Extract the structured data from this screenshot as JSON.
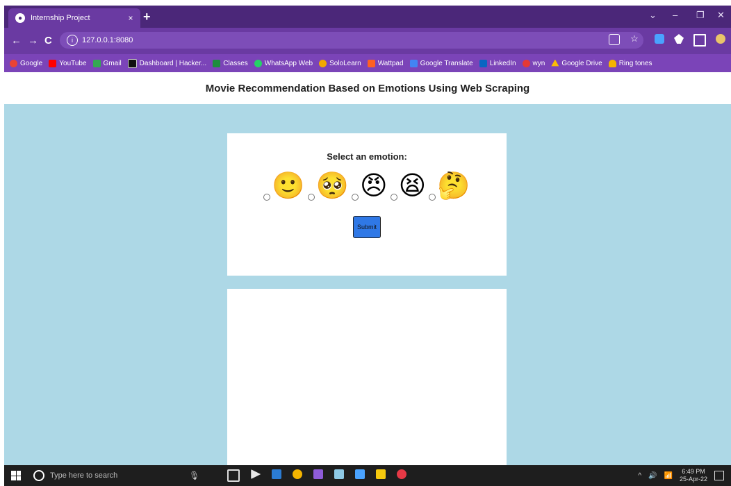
{
  "browser": {
    "tab_title": "Internship Project",
    "tab_close": "×",
    "new_tab": "+",
    "url": "127.0.0.1:8080",
    "window_controls": [
      "⌄",
      "–",
      "❐",
      "✕"
    ],
    "nav": {
      "back": "←",
      "forward": "→",
      "reload": "C"
    }
  },
  "bookmarks": [
    {
      "label": "Google",
      "color": "#ea4335"
    },
    {
      "label": "YouTube",
      "color": "#ff0000"
    },
    {
      "label": "Gmail",
      "color": "#34a853"
    },
    {
      "label": "Dashboard | Hacker...",
      "color": "#111111"
    },
    {
      "label": "Classes",
      "color": "#1e8e3e"
    },
    {
      "label": "WhatsApp Web",
      "color": "#25d366"
    },
    {
      "label": "SoloLearn",
      "color": "#f2a900"
    },
    {
      "label": "Wattpad",
      "color": "#ff6122"
    },
    {
      "label": "Google Translate",
      "color": "#4285f4"
    },
    {
      "label": "LinkedIn",
      "color": "#0a66c2"
    },
    {
      "label": "wyn",
      "color": "#e53935"
    },
    {
      "label": "Google Drive",
      "color": "#fbbc04"
    },
    {
      "label": "Ring tones",
      "color": "#f4b400"
    }
  ],
  "page": {
    "header_title": "Movie Recommendation Based on Emotions Using Web Scraping",
    "prompt": "Select an emotion:",
    "emotions": [
      {
        "emoji": "🙂",
        "icon": "smiling-face-icon"
      },
      {
        "emoji": "🥺",
        "icon": "pleading-face-icon"
      },
      {
        "emoji": "😠",
        "icon": "angry-face-icon"
      },
      {
        "emoji": "😫",
        "icon": "tired-face-icon"
      },
      {
        "emoji": "🤔",
        "icon": "thinking-face-icon"
      }
    ],
    "submit_label": "Submit",
    "accent_color": "#2f78e6",
    "page_background": "#add8e6"
  },
  "taskbar": {
    "search_placeholder": "Type here to search",
    "time": "6:49 PM",
    "date": "25-Apr-22"
  }
}
